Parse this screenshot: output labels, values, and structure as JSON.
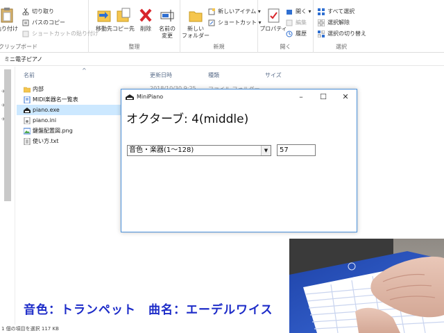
{
  "ribbon": {
    "clipboard": {
      "paste_label": "貼り付け",
      "cut_label": "切り取り",
      "copy_path_label": "パスのコピー",
      "paste_shortcut_label": "ショートカットの貼り付け",
      "group_label": "クリップボード"
    },
    "organize": {
      "move_to_label": "移動先",
      "copy_to_label": "コピー先",
      "delete_label": "削除",
      "rename_label": "名前の\n変更",
      "group_label": "整理"
    },
    "new": {
      "new_folder_label": "新しい\nフォルダー",
      "new_item_label": "新しいアイテム",
      "shortcut_label": "ショートカット",
      "group_label": "新規"
    },
    "open": {
      "properties_label": "プロパティ",
      "open_label": "開く",
      "edit_label": "編集",
      "history_label": "履歴",
      "group_label": "開く"
    },
    "select": {
      "select_all_label": "すべて選択",
      "select_none_label": "選択解除",
      "invert_label": "選択の切り替え",
      "group_label": "選択"
    }
  },
  "address": {
    "path": "ミニ電子ピアノ"
  },
  "filelist": {
    "columns": {
      "name": "名前",
      "date": "更新日時",
      "type": "種類",
      "size": "サイズ"
    },
    "partial_date": "2018/10/30 9:25",
    "partial_type": "ファイル フォルダー",
    "files": [
      {
        "name": "内部",
        "icon": "folder-icon"
      },
      {
        "name": "MIDI楽器名一覧表",
        "icon": "document-icon"
      },
      {
        "name": "piano.exe",
        "icon": "piano-app-icon"
      },
      {
        "name": "piano.ini",
        "icon": "ini-file-icon"
      },
      {
        "name": "鍵盤配置図.png",
        "icon": "image-file-icon"
      },
      {
        "name": "使い方.txt",
        "icon": "text-file-icon"
      }
    ]
  },
  "status": {
    "text": "1 個の項目を選択  117 KB"
  },
  "minipiano": {
    "title": "MiniPiano",
    "octave_text": "オクターブ: 4(middle)",
    "instrument_select": "音色・楽器(1〜128)",
    "instrument_number": "57"
  },
  "caption": {
    "text": "音色：トランペット　曲名：エーデルワイス"
  },
  "colors": {
    "caption": "#1c2bc8",
    "selected_row": "#cce8ff",
    "window_border": "#4a90d9"
  }
}
